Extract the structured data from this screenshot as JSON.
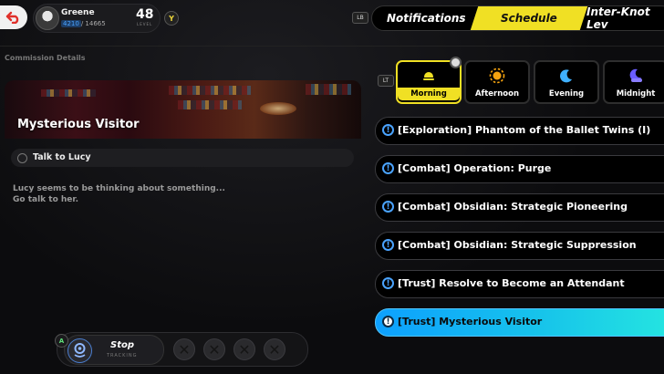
{
  "header": {
    "player_name": "Greene",
    "exp_current": "4210",
    "exp_total": "/ 14665",
    "level": "48",
    "level_caption": "LEVEL",
    "y_badge": "Y",
    "lb_badge": "LB",
    "tabs": [
      {
        "label": "Notifications",
        "active": false
      },
      {
        "label": "Schedule",
        "active": true
      },
      {
        "label": "Inter-Knot Lev",
        "active": false
      }
    ]
  },
  "commission_details": {
    "section_title": "Commission Details",
    "title": "Mysterious Visitor",
    "task": "Talk to Lucy",
    "description_line1": "Lucy seems to be thinking about something...",
    "description_line2": "Go talk to her."
  },
  "footer": {
    "a_badge": "A",
    "stop_label": "Stop",
    "stop_sub": "TRACKING",
    "empty_slots": [
      "✕",
      "✕",
      "✕",
      "✕"
    ]
  },
  "time_of_day": {
    "lt_badge": "LT",
    "options": [
      {
        "label": "Morning",
        "icon": "sunrise-icon",
        "active": true
      },
      {
        "label": "Afternoon",
        "icon": "sun-icon",
        "active": false
      },
      {
        "label": "Evening",
        "icon": "moon-icon",
        "active": false
      },
      {
        "label": "Midnight",
        "icon": "moon-cloud-icon",
        "active": false
      }
    ]
  },
  "commissions": [
    {
      "icon_glyph": "!",
      "label": "[Exploration] Phantom of the Ballet Twins (I)",
      "active": false
    },
    {
      "icon_glyph": "!",
      "label": "[Combat] Operation: Purge",
      "active": false
    },
    {
      "icon_glyph": "!",
      "label": "[Combat] Obsidian: Strategic Pioneering",
      "active": false
    },
    {
      "icon_glyph": "!",
      "label": "[Combat] Obsidian: Strategic Suppression",
      "active": false
    },
    {
      "icon_glyph": "!",
      "label": "[Trust] Resolve to Become an Attendant",
      "active": false
    },
    {
      "icon_glyph": "!",
      "label": "[Trust] Mysterious Visitor",
      "active": true
    }
  ],
  "colors": {
    "accent_yellow": "#f0e024",
    "accent_blue": "#0da0ff",
    "accent_cyan": "#25e6e0"
  }
}
